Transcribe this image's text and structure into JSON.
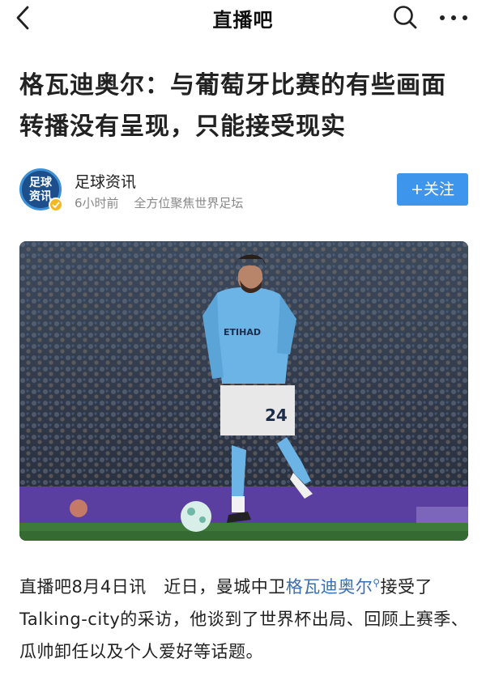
{
  "nav": {
    "title": "直播吧"
  },
  "article": {
    "title": "格瓦迪奥尔：与葡萄牙比赛的有些画面转播没有呈现，只能接受现实",
    "author": {
      "name": "足球资讯",
      "avatar_text": "足球资讯",
      "time": "6小时前",
      "tagline": "全方位聚焦世界足坛"
    },
    "follow_label": "+关注",
    "photo_jersey_number": "24",
    "photo_sponsor": "ETIHAD",
    "body": {
      "intro": "直播吧8月4日讯　近日，曼城中卫",
      "player_link": "格瓦迪奥尔",
      "rest": "接受了Talking-city的采访，他谈到了世界杯出局、回顾上赛季、瓜帅卸任以及个人爱好等话题。"
    }
  },
  "colors": {
    "accent": "#3d96ec",
    "link": "#3c6fb0",
    "meta": "#888888",
    "pitch_board": "#5b3fa0",
    "kit_blue": "#6cb4e6"
  }
}
